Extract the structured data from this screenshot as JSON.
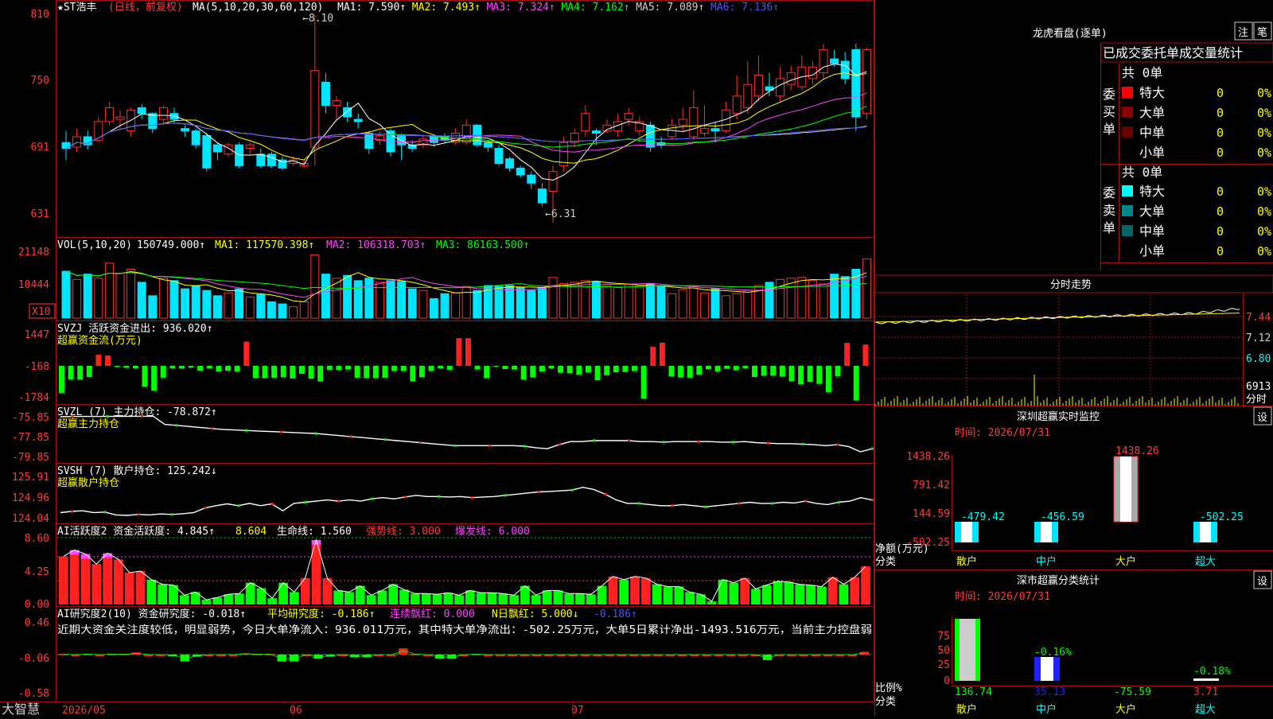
{
  "app": {
    "brand": "大智慧",
    "date_labels": [
      "2026/05",
      "06",
      "07"
    ]
  },
  "main": {
    "title": "★ST浩丰",
    "title_sub": "(日线，前复权)",
    "ma_text": "MA(5,10,20,30,60,120)",
    "ma_items": [
      {
        "label": "MA1: 7.590↑",
        "color": "#ffffff"
      },
      {
        "label": "MA2: 7.493↑",
        "color": "#ffff00"
      },
      {
        "label": "MA3: 7.324↑",
        "color": "#ff44ff"
      },
      {
        "label": "MA4: 7.162↑",
        "color": "#00ff00"
      },
      {
        "label": "MA5: 7.089↑",
        "color": "#cfcfcf"
      },
      {
        "label": "MA6: 7.136↑",
        "color": "#5050ff"
      }
    ],
    "y_ticks": [
      "810",
      "750",
      "691",
      "631"
    ],
    "high_marker": "←8.10",
    "low_marker": "←6.31"
  },
  "vol": {
    "title": "VOL(5,10,20)",
    "value": "150749.000↑",
    "ma1": "MA1: 117570.398↑",
    "ma2": "MA2: 106318.703↑",
    "ma3": "MA3: 86163.500↑",
    "y_ticks": [
      "21148",
      "10444"
    ],
    "unit": "X10"
  },
  "svzj": {
    "title": "SVZJ  活跃资金进出: 936.020↑",
    "subtitle": "超赢资金流(万元)",
    "y_ticks": [
      "1447",
      "-168",
      "-1784"
    ]
  },
  "svzl": {
    "title": "SVZL (7) 主力持仓: -78.872↑",
    "subtitle": "超赢主力持仓",
    "y_ticks": [
      "-75.85",
      "-77.85",
      "-79.85"
    ]
  },
  "svsh": {
    "title": "SVSH (7) 散户持仓: 125.242↓",
    "subtitle": "超赢散户持仓",
    "y_ticks": [
      "125.91",
      "124.96",
      "124.04"
    ]
  },
  "ai1": {
    "title": "AI活跃度2 资金活跃度: 4.845↑",
    "v2": "8.604",
    "life": "生命线: 1.560",
    "strong": "强势线: 3.000",
    "burst": "爆发线: 6.000",
    "y_ticks": [
      "8.60",
      "4.25",
      "0.00"
    ]
  },
  "ai2": {
    "title": "AI研究度2(10) 资金研究度: -0.018↑",
    "avg": "平均研究度: -0.186↑",
    "red": "连续飘红: 0.000",
    "nred": "N日飘红: 5.000↓",
    "last": "-0.186↑",
    "comment": "近期大资金关注度较低，明显弱势，今日大单净流入：936.011万元，其中特大单净流出：-502.25万元，大单5日累计净出-1493.516万元，当前主力控盘弱",
    "y_ticks": [
      "0.46",
      "-0.06",
      "-0.58"
    ]
  },
  "dragon": {
    "title": "龙虎看盘(逐单)",
    "btn1": "注",
    "btn2": "笔",
    "tabs": [
      "已成交",
      "委托单",
      "成交量统计"
    ],
    "buy_label": "委买单",
    "sell_label": "委卖单",
    "buy_total": "共 0单",
    "sell_total": "共 0单",
    "buy_rows": [
      {
        "name": "特大",
        "count": "0",
        "pct": "0%",
        "color": "#ff0000"
      },
      {
        "name": "大单",
        "count": "0",
        "pct": "0%",
        "color": "#880000"
      },
      {
        "name": "中单",
        "count": "0",
        "pct": "0%",
        "color": "#660000"
      },
      {
        "name": "小单",
        "count": "0",
        "pct": "0%",
        "color": ""
      }
    ],
    "sell_rows": [
      {
        "name": "特大",
        "count": "0",
        "pct": "0%",
        "color": "#00ffff"
      },
      {
        "name": "大单",
        "count": "0",
        "pct": "0%",
        "color": "#008888"
      },
      {
        "name": "中单",
        "count": "0",
        "pct": "0%",
        "color": "#006666"
      },
      {
        "name": "小单",
        "count": "0",
        "pct": "0%",
        "color": ""
      }
    ]
  },
  "intraday": {
    "title": "分时走势",
    "y_ticks": [
      "7.44",
      "7.12",
      "6.80"
    ],
    "vol_label": "6913",
    "vol_unit": "分时"
  },
  "monitor": {
    "title": "深圳超赢实时监控",
    "btn": "设",
    "time": "时间: 2026/07/31",
    "y_ticks": [
      "1438.26",
      "791.42",
      "144.59",
      "-502.25"
    ],
    "unit1": "净额(万元)",
    "unit2": "分类",
    "cats": [
      "散户",
      "中户",
      "大户",
      "超大"
    ]
  },
  "stats": {
    "title": "深市超赢分类统计",
    "btn": "设",
    "time": "时间: 2026/07/31",
    "y_ticks": [
      "75",
      "50",
      "25",
      "0"
    ],
    "unit1": "比例%",
    "unit2": "分类",
    "cats": [
      "散户",
      "中户",
      "大户",
      "超大"
    ]
  },
  "chart_data": [
    {
      "type": "candlestick",
      "name": "daily",
      "ylim": [
        6.2,
        8.2
      ],
      "ohlc": [
        [
          7.0,
          6.95,
          7.1,
          6.85
        ],
        [
          6.96,
          7.05,
          7.12,
          6.92
        ],
        [
          7.05,
          6.98,
          7.1,
          6.94
        ],
        [
          7.02,
          7.18,
          7.22,
          7.0
        ],
        [
          7.18,
          7.3,
          7.35,
          7.15
        ],
        [
          7.2,
          7.22,
          7.28,
          7.12
        ],
        [
          7.1,
          7.28,
          7.3,
          7.05
        ],
        [
          7.3,
          7.25,
          7.33,
          7.2
        ],
        [
          7.25,
          7.12,
          7.26,
          7.08
        ],
        [
          7.2,
          7.3,
          7.32,
          7.15
        ],
        [
          7.25,
          7.2,
          7.3,
          7.16
        ],
        [
          7.12,
          7.1,
          7.15,
          7.05
        ],
        [
          7.1,
          6.98,
          7.12,
          6.95
        ],
        [
          7.06,
          6.78,
          7.08,
          6.75
        ],
        [
          6.98,
          6.92,
          7.0,
          6.85
        ],
        [
          6.9,
          6.98,
          7.0,
          6.88
        ],
        [
          6.98,
          6.8,
          7.0,
          6.78
        ],
        [
          6.95,
          6.98,
          7.0,
          6.9
        ],
        [
          6.9,
          6.8,
          6.95,
          6.78
        ],
        [
          6.9,
          6.8,
          6.92,
          6.78
        ],
        [
          6.85,
          6.78,
          6.88,
          6.76
        ],
        [
          6.82,
          6.85,
          6.88,
          6.8
        ],
        [
          6.8,
          6.82,
          6.85,
          6.78
        ],
        [
          6.96,
          7.62,
          8.1,
          6.8
        ],
        [
          7.52,
          7.32,
          7.6,
          7.25
        ],
        [
          7.32,
          7.36,
          7.4,
          7.2
        ],
        [
          7.3,
          7.22,
          7.35,
          7.18
        ],
        [
          7.2,
          7.18,
          7.25,
          7.12
        ],
        [
          7.08,
          6.95,
          7.1,
          6.9
        ],
        [
          7.02,
          7.06,
          7.1,
          6.98
        ],
        [
          7.1,
          6.92,
          7.12,
          6.88
        ],
        [
          7.06,
          6.98,
          7.08,
          6.85
        ],
        [
          6.98,
          6.95,
          7.02,
          6.92
        ],
        [
          6.98,
          7.03,
          7.06,
          6.95
        ],
        [
          7.05,
          7.0,
          7.07,
          6.96
        ],
        [
          7.05,
          7.02,
          7.08,
          7.0
        ],
        [
          7.0,
          7.08,
          7.12,
          6.98
        ],
        [
          7.0,
          7.15,
          7.2,
          6.98
        ],
        [
          7.15,
          6.98,
          7.16,
          6.96
        ],
        [
          7.0,
          6.96,
          7.02,
          6.92
        ],
        [
          6.95,
          6.82,
          6.98,
          6.8
        ],
        [
          6.86,
          6.78,
          6.88,
          6.75
        ],
        [
          6.78,
          6.72,
          6.8,
          6.7
        ],
        [
          6.72,
          6.65,
          6.75,
          6.6
        ],
        [
          6.6,
          6.48,
          6.65,
          6.45
        ],
        [
          6.58,
          6.75,
          6.8,
          6.31
        ],
        [
          6.8,
          7.0,
          7.05,
          6.75
        ],
        [
          7.0,
          7.08,
          7.12,
          6.96
        ],
        [
          7.1,
          7.25,
          7.32,
          7.05
        ],
        [
          7.1,
          7.08,
          7.12,
          6.98
        ],
        [
          7.1,
          7.15,
          7.2,
          7.08
        ],
        [
          7.1,
          7.18,
          7.25,
          7.05
        ],
        [
          7.2,
          7.25,
          7.3,
          7.15
        ],
        [
          7.1,
          7.18,
          7.22,
          7.06
        ],
        [
          7.15,
          6.96,
          7.18,
          6.92
        ],
        [
          7.0,
          6.98,
          7.05,
          6.95
        ],
        [
          7.05,
          7.15,
          7.2,
          7.02
        ],
        [
          7.15,
          7.2,
          7.3,
          7.1
        ],
        [
          7.05,
          7.3,
          7.45,
          7.02
        ],
        [
          7.08,
          7.12,
          7.32,
          7.05
        ],
        [
          7.12,
          7.1,
          7.18,
          7.0
        ],
        [
          7.1,
          7.28,
          7.35,
          7.08
        ],
        [
          7.25,
          7.4,
          7.58,
          7.2
        ],
        [
          7.3,
          7.5,
          7.7,
          7.25
        ],
        [
          7.4,
          7.58,
          7.75,
          7.35
        ],
        [
          7.48,
          7.45,
          7.6,
          7.4
        ],
        [
          7.4,
          7.55,
          7.65,
          7.35
        ],
        [
          7.5,
          7.6,
          7.66,
          7.45
        ],
        [
          7.48,
          7.65,
          7.75,
          7.45
        ],
        [
          7.55,
          7.65,
          7.7,
          7.5
        ],
        [
          7.6,
          7.8,
          7.85,
          7.55
        ],
        [
          7.72,
          7.68,
          7.8,
          7.65
        ],
        [
          7.7,
          7.55,
          7.78,
          7.5
        ],
        [
          7.8,
          7.22,
          7.85,
          7.1
        ],
        [
          7.25,
          7.8,
          7.82,
          7.2
        ]
      ]
    },
    {
      "type": "bar",
      "name": "volume",
      "values": [
        115,
        95,
        108,
        98,
        135,
        110,
        120,
        88,
        55,
        98,
        92,
        72,
        80,
        68,
        55,
        62,
        72,
        52,
        58,
        40,
        35,
        28,
        40,
        155,
        108,
        98,
        105,
        92,
        98,
        88,
        92,
        90,
        72,
        68,
        48,
        60,
        62,
        78,
        68,
        80,
        78,
        80,
        75,
        68,
        75,
        100,
        85,
        88,
        92,
        90,
        80,
        75,
        82,
        78,
        85,
        78,
        60,
        70,
        78,
        62,
        72,
        55,
        60,
        68,
        80,
        88,
        95,
        98,
        100,
        92,
        84,
        108,
        102,
        120,
        145
      ]
    },
    {
      "type": "bar",
      "name": "svzj",
      "values": [
        -1100,
        -550,
        -560,
        -450,
        450,
        420,
        -50,
        -80,
        -100,
        -850,
        -1000,
        -480,
        -100,
        -110,
        -70,
        -200,
        -100,
        -230,
        -200,
        -230,
        980,
        -500,
        -500,
        -480,
        -460,
        -510,
        -320,
        -520,
        -630,
        -160,
        -170,
        -150,
        -480,
        -500,
        -500,
        -480,
        -210,
        -210,
        -630,
        -460,
        -210,
        -100,
        -160,
        1120,
        1120,
        -150,
        -500,
        -30,
        -130,
        -150,
        -560,
        -470,
        -230,
        -100,
        -280,
        -300,
        -360,
        -270,
        -580,
        -380,
        -260,
        -250,
        -210,
        -1330,
        770,
        940,
        -430,
        -470,
        -480,
        -360,
        -140,
        -230,
        -120,
        -180,
        -100,
        -450,
        -400,
        -400,
        -440,
        -620,
        -750,
        -650,
        -730,
        -1070,
        -420,
        930,
        -1400,
        860
      ]
    },
    {
      "type": "line",
      "name": "svzl",
      "values": [
        -75.85,
        -75.83,
        -75.82,
        -75.82,
        -75.82,
        -75.81,
        -75.8,
        -75.8,
        -75.8,
        -76.6,
        -76.7,
        -76.8,
        -76.9,
        -77.0,
        -77.1,
        -77.15,
        -77.2,
        -77.25,
        -77.3,
        -77.35,
        -77.4,
        -77.45,
        -77.5,
        -77.6,
        -77.7,
        -77.8,
        -77.9,
        -78.0,
        -78.1,
        -78.2,
        -78.3,
        -78.4,
        -78.5,
        -78.6,
        -78.7,
        -78.7,
        -78.7,
        -78.7,
        -78.7,
        -78.7,
        -78.75,
        -78.9,
        -79.0,
        -78.6,
        -78.3,
        -78.3,
        -78.2,
        -78.2,
        -78.2,
        -78.2,
        -78.3,
        -78.3,
        -78.35,
        -78.3,
        -78.3,
        -78.3,
        -78.3,
        -78.35,
        -78.35,
        -78.3,
        -78.4,
        -78.45,
        -78.5,
        -78.5,
        -78.55,
        -78.6,
        -78.7,
        -78.6,
        -78.8,
        -79.3,
        -79.0
      ]
    },
    {
      "type": "line",
      "name": "svsh",
      "values": [
        124.3,
        124.35,
        124.38,
        124.3,
        124.32,
        124.2,
        124.18,
        124.22,
        124.2,
        124.24,
        124.22,
        124.25,
        124.3,
        124.5,
        124.6,
        124.68,
        124.6,
        124.7,
        124.6,
        124.68,
        124.38,
        124.7,
        124.75,
        124.8,
        124.85,
        124.8,
        124.85,
        124.8,
        124.9,
        124.95,
        124.9,
        124.98,
        125.05,
        125.0,
        125.0,
        124.98,
        125.0,
        124.95,
        124.98,
        125.0,
        125.05,
        125.1,
        125.15,
        125.2,
        125.22,
        125.25,
        125.28,
        125.4,
        125.3,
        125.1,
        124.85,
        124.7,
        124.7,
        124.65,
        124.6,
        124.6,
        124.65,
        124.6,
        124.55,
        124.6,
        124.65,
        124.7,
        124.75,
        124.7,
        124.7,
        124.75,
        124.72,
        124.8,
        124.7,
        124.65,
        124.75,
        124.8,
        124.95,
        124.85
      ]
    },
    {
      "type": "bar",
      "name": "ai_activity",
      "values": [
        6.2,
        7.0,
        6.5,
        5.2,
        6.6,
        5.8,
        4.1,
        4.3,
        3.2,
        2.6,
        2.5,
        1.2,
        1.6,
        0.6,
        0.9,
        1.3,
        1.4,
        2.8,
        2.1,
        0.8,
        2.8,
        1.6,
        3.4,
        8.3,
        3.4,
        1.8,
        1.6,
        2.4,
        1.2,
        1.8,
        2.6,
        1.9,
        1.4,
        1.4,
        1.3,
        1.5,
        1.2,
        1.8,
        1.5,
        1.5,
        1.4,
        1.2,
        2.4,
        1.2,
        1.8,
        1.8,
        1.4,
        1.4,
        1.3,
        2.4,
        3.6,
        3.2,
        3.6,
        3.4,
        2.6,
        2.3,
        2.3,
        1.6,
        1.3,
        0.4,
        3.2,
        2.8,
        3.4,
        2.0,
        2.5,
        3.0,
        2.9,
        2.6,
        2.5,
        2.3,
        3.5,
        2.6,
        3.5,
        4.9
      ]
    },
    {
      "type": "bar",
      "name": "ai_research",
      "values": [
        -0.05,
        -0.06,
        -0.05,
        -0.06,
        -0.05,
        -0.05,
        -0.03,
        -0.06,
        -0.06,
        -0.07,
        -0.16,
        -0.09,
        -0.06,
        -0.06,
        -0.06,
        -0.04,
        -0.05,
        -0.05,
        -0.16,
        -0.16,
        -0.06,
        -0.12,
        -0.09,
        -0.06,
        -0.1,
        -0.1,
        -0.06,
        -0.06,
        0.03,
        -0.05,
        -0.06,
        -0.12,
        -0.12,
        -0.06,
        -0.05,
        -0.06,
        -0.06,
        -0.06,
        -0.06,
        -0.06,
        -0.06,
        -0.06,
        -0.06,
        -0.06,
        -0.06,
        -0.06,
        -0.06,
        -0.06,
        -0.06,
        -0.06,
        -0.06,
        -0.06,
        -0.06,
        -0.06,
        -0.06,
        -0.06,
        -0.06,
        -0.06,
        -0.14,
        -0.06,
        -0.06,
        -0.06,
        -0.06,
        -0.06,
        -0.06,
        -0.06,
        -0.02
      ]
    },
    {
      "type": "bar",
      "name": "monitor",
      "categories": [
        "散户",
        "中户",
        "大户",
        "超大"
      ],
      "values": [
        -479.42,
        -456.59,
        1438.26,
        -502.25
      ],
      "labels": [
        "-479.42",
        "-456.59",
        "1438.26",
        "-502.25"
      ]
    },
    {
      "type": "bar",
      "name": "stats",
      "categories": [
        "散户",
        "中户",
        "大户",
        "超大"
      ],
      "values": [
        136.74,
        35.13,
        -75.59,
        3.71
      ],
      "labels": [
        "136.74",
        "35.13",
        "-75.59",
        "3.71"
      ],
      "annotations": [
        "-0.16%",
        "-0.18%"
      ]
    }
  ]
}
